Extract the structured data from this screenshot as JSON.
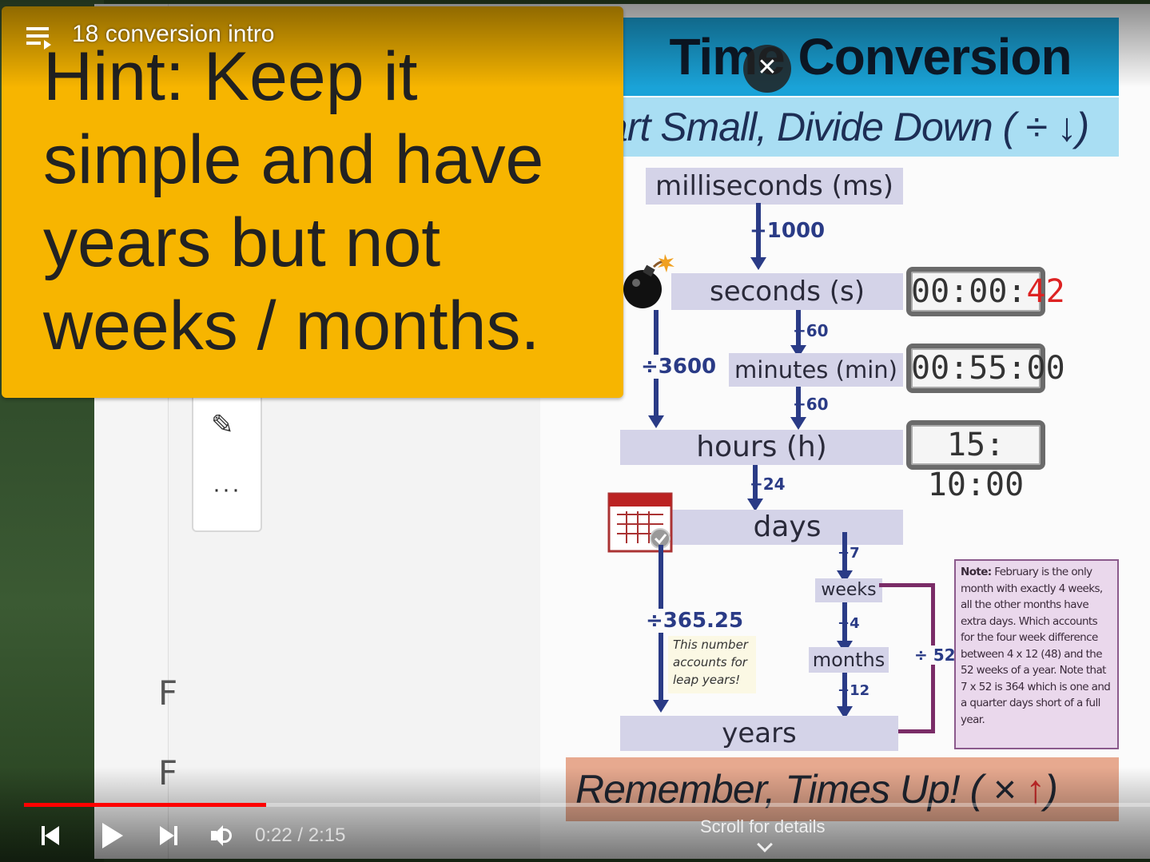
{
  "player": {
    "title": "18 conversion intro",
    "time_display": "0:22 / 2:15",
    "progress_fraction": 0.215,
    "scroll_hint": "Scroll for details",
    "close_glyph": "✕"
  },
  "hint": {
    "lines": [
      "Hint: Keep it",
      "simple and have",
      "years but not",
      "weeks / months."
    ]
  },
  "board": {
    "letters": [
      "F",
      "F"
    ],
    "more_glyph": "···"
  },
  "poster": {
    "title": "Time Conversion",
    "subtitle": "art Small, Divide Down  ( ÷ ↓)",
    "units": {
      "ms": "milliseconds (ms)",
      "s": "seconds (s)",
      "min": "minutes (min)",
      "h": "hours (h)",
      "days": "days",
      "weeks": "weeks",
      "months": "months",
      "years": "years"
    },
    "dividers": {
      "ms_s": "÷1000",
      "s_min": "÷60",
      "s_h": "÷3600",
      "min_h": "÷60",
      "h_days": "÷24",
      "days_weeks": "÷7",
      "weeks_months": "÷4",
      "months_years": "÷12",
      "days_years": "÷365.25",
      "weeks_years": "÷ 52"
    },
    "clocks": {
      "seconds_main": "00:00:",
      "seconds_red": "42",
      "minutes": "00:55:00",
      "hours": "15: 10:00"
    },
    "leap_note": "This number accounts for leap years!",
    "note_label": "Note:",
    "note_text": "February is the only month with exactly 4 weeks, all the other months have extra days. Which accounts for the four week difference between 4 x 12 (48) and the 52 weeks of a year. Note that 7 x 52 is 364 which is one and a quarter days short of a full year.",
    "remember": "Remember, Times Up!   ( × ",
    "remember_arrow": "↑",
    "remember_close": ")"
  },
  "colors": {
    "progress": "#ff0000",
    "hint_card": "#f7b500",
    "title_bar": "#1aa3d8",
    "arrow": "#2a3b86"
  },
  "icons": [
    "playlist-icon",
    "close-icon",
    "bomb-icon",
    "calendar-icon",
    "pen-icon",
    "previous-icon",
    "play-icon",
    "next-icon",
    "volume-icon",
    "chevron-down-icon"
  ]
}
